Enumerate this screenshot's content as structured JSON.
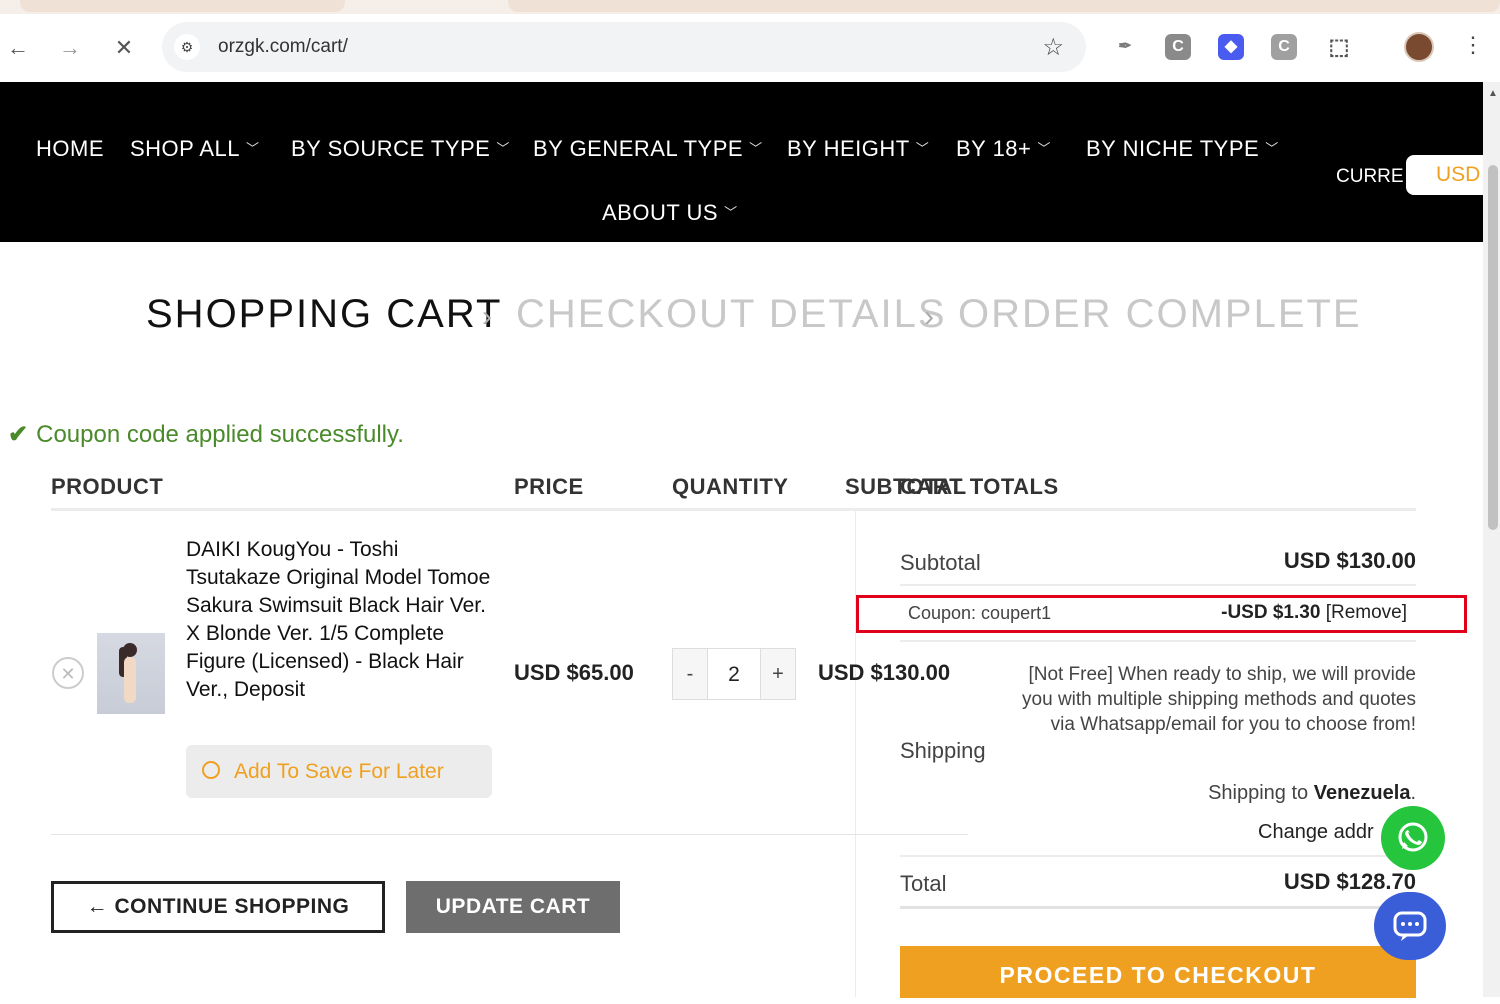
{
  "browser": {
    "url": "orzgk.com/cart/",
    "back_glyph": "←",
    "forward_glyph": "→",
    "stop_glyph": "✕",
    "star_glyph": "☆",
    "menu_glyph": "⋮",
    "extensions": [
      {
        "icon": "ink-icon",
        "glyph": "✒",
        "color": "#7c7c7c"
      },
      {
        "icon": "c-extension-icon",
        "glyph": "C",
        "color": "#8a8a8a"
      },
      {
        "icon": "tag-extension-icon",
        "glyph": "◆",
        "color": "#4a5bf0"
      },
      {
        "icon": "c2-extension-icon",
        "glyph": "C",
        "color": "#a0a0a0"
      },
      {
        "icon": "puzzle-icon",
        "glyph": "⬚",
        "color": "#555555"
      }
    ]
  },
  "nav": {
    "items": [
      "HOME",
      "SHOP ALL",
      "BY SOURCE TYPE",
      "BY GENERAL TYPE",
      "BY HEIGHT",
      "BY 18+",
      "BY NICHE TYPE",
      "ABOUT US"
    ],
    "currency_label": "CURRE",
    "currency_value": "USD"
  },
  "steps": [
    "SHOPPING CART",
    "CHECKOUT DETAILS",
    "ORDER COMPLETE"
  ],
  "notice": "Coupon code applied successfully.",
  "table": {
    "headers": {
      "product": "PRODUCT",
      "price": "PRICE",
      "quantity": "QUANTITY",
      "subtotal": "SUBTOTAL"
    },
    "row": {
      "name": "DAIKI KougYou - Toshi Tsutakaze Original Model Tomoe Sakura Swimsuit Black Hair Ver. X Blonde Ver. 1/5 Complete Figure (Licensed) - Black Hair Ver., Deposit",
      "save_later": "Add To Save For Later",
      "price": "USD $65.00",
      "quantity": "2",
      "minus": "-",
      "plus": "+",
      "subtotal": "USD $130.00"
    }
  },
  "buttons": {
    "continue": "← CONTINUE SHOPPING",
    "update": "UPDATE CART"
  },
  "totals": {
    "heading": "CART TOTALS",
    "subtotal_label": "Subtotal",
    "subtotal_value": "USD $130.00",
    "coupon_label": "Coupon: coupert1",
    "coupon_value": "-USD $1.30",
    "coupon_remove": "[Remove]",
    "shipping_label": "Shipping",
    "shipping_note": "[Not Free] When ready to ship, we will provide you with multiple shipping methods and quotes via Whatsapp/email for you to choose from!",
    "shipping_to_prefix": "Shipping to",
    "shipping_to_country": "Venezuela",
    "shipping_to_suffix": ".",
    "change_address": "Change addr",
    "total_label": "Total",
    "total_value": "USD $128.70",
    "checkout": "PROCEED TO CHECKOUT"
  },
  "colors": {
    "accent": "#f0a020",
    "success": "#4a8a2a",
    "highlight_border": "#e0001a",
    "whatsapp": "#25c53d",
    "chat": "#3a5ed8"
  }
}
